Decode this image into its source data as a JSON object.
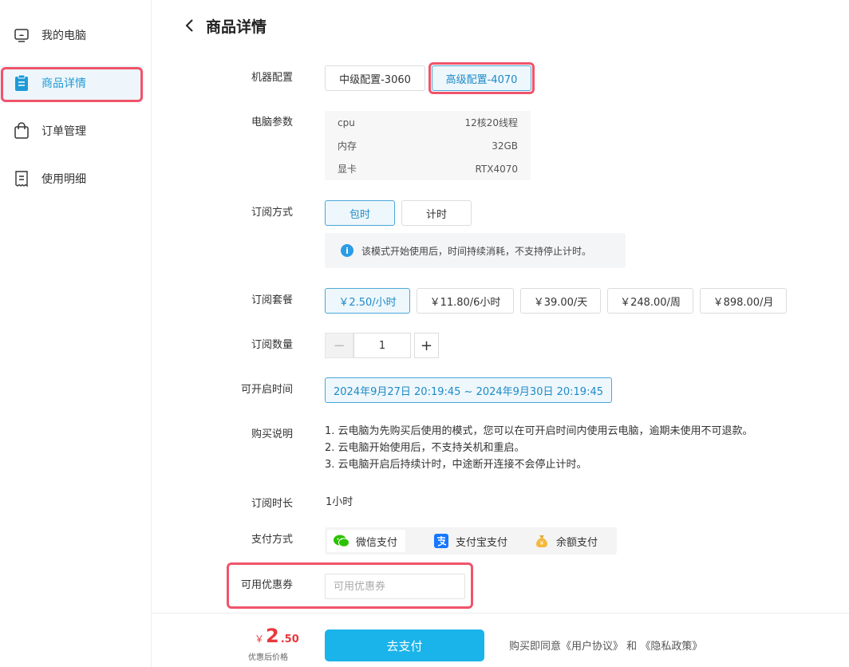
{
  "sidebar": {
    "items": [
      {
        "label": "我的电脑",
        "icon": "monitor-icon"
      },
      {
        "label": "商品详情",
        "icon": "clipboard-icon"
      },
      {
        "label": "订单管理",
        "icon": "shopping-bag-icon"
      },
      {
        "label": "使用明细",
        "icon": "receipt-icon"
      }
    ],
    "active_index": 1
  },
  "header": {
    "title": "商品详情",
    "back_icon": "chevron-left-icon"
  },
  "form": {
    "machine_config": {
      "label": "机器配置",
      "options": [
        "中级配置-3060",
        "高级配置-4070"
      ],
      "selected": "高级配置-4070"
    },
    "params": {
      "label": "电脑参数",
      "rows": [
        {
          "key": "cpu",
          "value": "12核20线程"
        },
        {
          "key": "内存",
          "value": "32GB"
        },
        {
          "key": "显卡",
          "value": "RTX4070"
        }
      ]
    },
    "subscription_mode": {
      "label": "订阅方式",
      "options": [
        "包时",
        "计时"
      ],
      "selected": "包时",
      "info": "该模式开始使用后，时间持续消耗，不支持停止计时。"
    },
    "plans": {
      "label": "订阅套餐",
      "options": [
        "￥2.50/小时",
        "￥11.80/6小时",
        "￥39.00/天",
        "￥248.00/周",
        "￥898.00/月"
      ],
      "selected": "￥2.50/小时"
    },
    "quantity": {
      "label": "订阅数量",
      "value": "1",
      "minus": "−",
      "plus": "+"
    },
    "start_time": {
      "label": "可开启时间",
      "range": "2024年9月27日 20:19:45 ~ 2024年9月30日 20:19:45"
    },
    "notes": {
      "label": "购买说明",
      "lines": [
        "1. 云电脑为先购买后使用的模式，您可以在可开启时间内使用云电脑，逾期未使用不可退款。",
        "2. 云电脑开始使用后，不支持关机和重启。",
        "3. 云电脑开启后持续计时，中途断开连接不会停止计时。"
      ]
    },
    "duration": {
      "label": "订阅时长",
      "value": "1小时"
    },
    "payment": {
      "label": "支付方式",
      "options": [
        {
          "label": "微信支付",
          "icon": "wechat-icon"
        },
        {
          "label": "支付宝支付",
          "icon": "alipay-icon"
        },
        {
          "label": "余额支付",
          "icon": "money-bag-icon"
        }
      ],
      "selected": "微信支付"
    },
    "coupon": {
      "label": "可用优惠券",
      "placeholder": "可用优惠券",
      "value": ""
    }
  },
  "footer": {
    "price_currency": "￥",
    "price_int": "2",
    "price_dec": ".50",
    "price_note": "优惠后价格",
    "pay_button": "去支付",
    "agree_prefix": "购买即同意",
    "user_agreement": "《用户协议》",
    "agree_and": "和",
    "privacy_policy": "《隐私政策》"
  },
  "colors": {
    "accent": "#1ab3ea",
    "highlight": "#f0546b",
    "price": "#e8383d",
    "selected_text": "#1e8ac8"
  }
}
